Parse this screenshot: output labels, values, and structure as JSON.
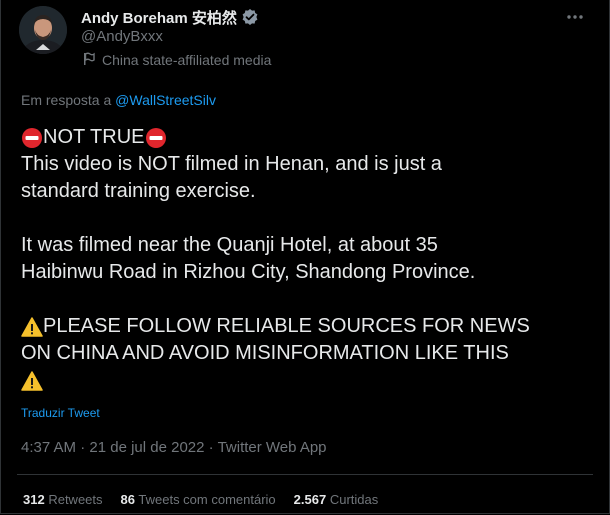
{
  "author": {
    "name": "Andy Boreham 安柏然",
    "handle": "@AndyBxxx",
    "affiliation_label": "China state-affiliated media",
    "verified_icon": "verified-badge-icon",
    "avatar_icon": "profile-photo"
  },
  "reply": {
    "prefix": "Em resposta a ",
    "mention": "@WallStreetSilv"
  },
  "tweet": {
    "line1": "NOT TRUE",
    "line2": "This video is NOT filmed in Henan, and is just a",
    "line3": "standard training exercise.",
    "line4": "It was filmed near the Quanji Hotel, at about 35",
    "line5": "Haibinwu Road in Rizhou City, Shandong Province.",
    "line6": "PLEASE FOLLOW RELIABLE SOURCES FOR NEWS",
    "line7": "ON CHINA AND AVOID MISINFORMATION LIKE THIS"
  },
  "translate_label": "Traduzir Tweet",
  "meta": {
    "time": "4:37 AM",
    "separator1": " · ",
    "date": "21 de jul de 2022",
    "separator2": " · ",
    "source": "Twitter Web App"
  },
  "stats": {
    "retweets_count": "312",
    "retweets_label": "Retweets",
    "quotes_count": "86",
    "quotes_label": "Tweets com comentário",
    "likes_count": "2.567",
    "likes_label": "Curtidas"
  },
  "colors": {
    "background": "#000000",
    "text": "#e7e9ea",
    "muted": "#71767b",
    "link": "#1d9bf0",
    "no_entry_red": "#e0262d",
    "warning_yellow": "#f5c02c"
  }
}
